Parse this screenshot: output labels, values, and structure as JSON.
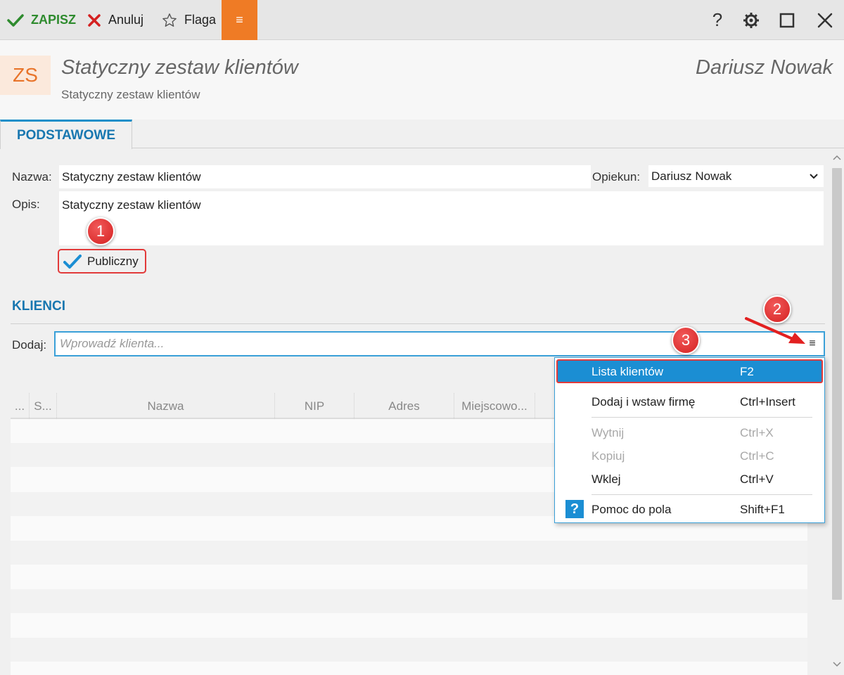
{
  "toolbar": {
    "save_label": "ZAPISZ",
    "cancel_label": "Anuluj",
    "flag_label": "Flaga",
    "menu_glyph": "≡",
    "help_glyph": "?"
  },
  "header": {
    "badge": "ZS",
    "title": "Statyczny zestaw klientów",
    "subtitle": "Statyczny zestaw klientów",
    "user": "Dariusz Nowak"
  },
  "tabs": [
    {
      "label": "PODSTAWOWE",
      "active": true
    }
  ],
  "form": {
    "name_label": "Nazwa:",
    "name_value": "Statyczny zestaw klientów",
    "owner_label": "Opiekun:",
    "owner_value": "Dariusz Nowak",
    "description_label": "Opis:",
    "description_value": "Statyczny zestaw klientów",
    "public_label": "Publiczny",
    "public_checked": true
  },
  "clients": {
    "section_title": "KLIENCI",
    "add_label": "Dodaj:",
    "add_placeholder": "Wprowadź klienta...",
    "add_menu_glyph": "≡",
    "columns": [
      "...",
      "S...",
      "Nazwa",
      "NIP",
      "Adres",
      "Miejscowo..."
    ],
    "rows": []
  },
  "context_menu": {
    "items": [
      {
        "label": "Lista klientów",
        "shortcut": "F2",
        "highlighted": true,
        "enabled": true
      },
      {
        "label": "Dodaj i wstaw firmę",
        "shortcut": "Ctrl+Insert",
        "enabled": true
      },
      {
        "label": "Wytnij",
        "shortcut": "Ctrl+X",
        "enabled": false
      },
      {
        "label": "Kopiuj",
        "shortcut": "Ctrl+C",
        "enabled": false
      },
      {
        "label": "Wklej",
        "shortcut": "Ctrl+V",
        "enabled": true
      },
      {
        "label": "Pomoc do pola",
        "shortcut": "Shift+F1",
        "enabled": true,
        "icon": "help-icon"
      }
    ]
  },
  "callouts": [
    "1",
    "2",
    "3"
  ],
  "colors": {
    "accent_orange": "#ef7b25",
    "accent_blue": "#1877b0",
    "highlight_blue": "#1b8ed3",
    "save_green": "#2e8b2e",
    "callout_red": "#d42020"
  }
}
